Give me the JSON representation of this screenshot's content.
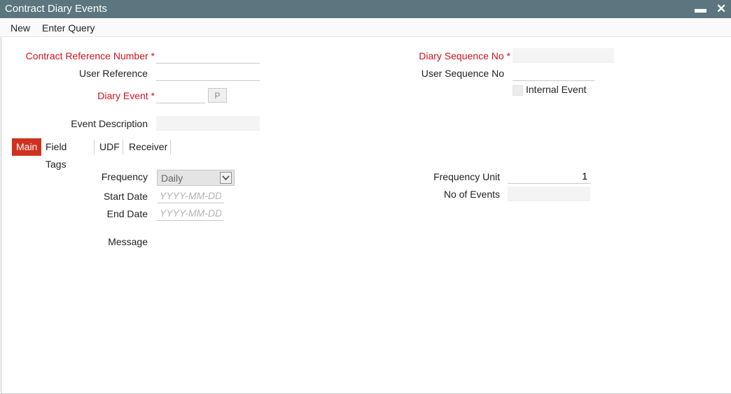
{
  "window": {
    "title": "Contract Diary Events",
    "minimize_symbol": "▬",
    "close_symbol": "✕"
  },
  "menu": {
    "new": "New",
    "enter_query": "Enter Query"
  },
  "header": {
    "contract_reference_number": {
      "label": "Contract Reference Number",
      "value": "",
      "required_mark": "*"
    },
    "user_reference": {
      "label": "User Reference",
      "value": ""
    },
    "diary_event": {
      "label": "Diary Event",
      "value": "",
      "required_mark": "*",
      "lookup_button": "P"
    },
    "event_description": {
      "label": "Event Description",
      "value": ""
    },
    "diary_sequence_no": {
      "label": "Diary Sequence No",
      "value": "",
      "required_mark": "*"
    },
    "user_sequence_no": {
      "label": "User Sequence No",
      "value": ""
    },
    "internal_event": {
      "label": "Internal Event",
      "checked": false
    }
  },
  "tabs": [
    {
      "label": "Main",
      "active": true
    },
    {
      "label": "Field Tags",
      "active": false
    },
    {
      "label": "UDF",
      "active": false
    },
    {
      "label": "Receiver",
      "active": false
    }
  ],
  "main": {
    "frequency": {
      "label": "Frequency",
      "value": "Daily"
    },
    "start_date": {
      "label": "Start Date",
      "placeholder": "YYYY-MM-DD"
    },
    "end_date": {
      "label": "End Date",
      "placeholder": "YYYY-MM-DD"
    },
    "message": {
      "label": "Message"
    },
    "frequency_unit": {
      "label": "Frequency Unit",
      "value": "1"
    },
    "no_of_events": {
      "label": "No of Events",
      "value": ""
    }
  },
  "colors": {
    "titlebar": "#5b767e",
    "required": "#d0131f",
    "active_tab": "#d0311f"
  }
}
